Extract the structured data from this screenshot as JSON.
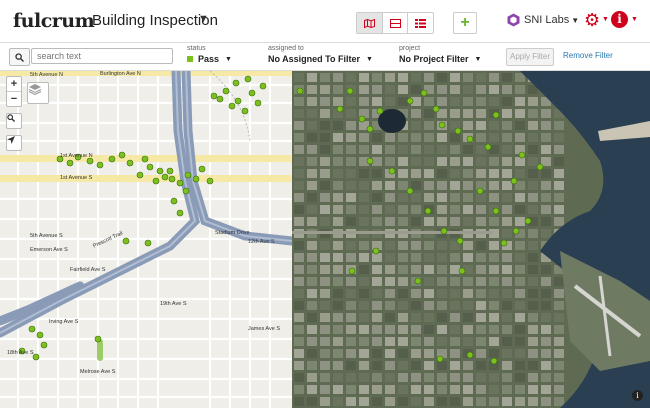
{
  "app": {
    "logo": "fulcrum",
    "title": "Building Inspection",
    "org": "SNI Labs"
  },
  "toolbar": {
    "views": [
      {
        "name": "map-view",
        "icon": "map-icon",
        "active": true
      },
      {
        "name": "split-view",
        "icon": "split-icon",
        "active": false
      },
      {
        "name": "table-view",
        "icon": "table-icon",
        "active": false
      }
    ],
    "add_icon": "plus-icon",
    "settings_icon": "gear-icon",
    "info_icon": "info-icon"
  },
  "filters": {
    "search_placeholder": "search text",
    "status": {
      "label": "status",
      "value": "Pass",
      "color": "#7cc01e"
    },
    "assigned": {
      "label": "assigned to",
      "value": "No Assigned To Filter"
    },
    "project": {
      "label": "project",
      "value": "No Project Filter"
    },
    "apply_label": "Apply Filter",
    "remove_label": "Remove Filter"
  },
  "map": {
    "zoom_in": "+",
    "zoom_out": "−",
    "marker_color": "#7cc01e",
    "street_labels": [
      "5th Avenue N",
      "1st Avenue N",
      "1st Avenue S",
      "5th Avenue S",
      "Emerson Ave S",
      "Fairfield Ave S",
      "Stadium Drive",
      "12th Ave S",
      "Irving Ave S",
      "18th Ave S",
      "Melrose Ave S",
      "James Ave S",
      "Prescott Trail",
      "19th Ave S",
      "Burlington Ave N"
    ]
  }
}
